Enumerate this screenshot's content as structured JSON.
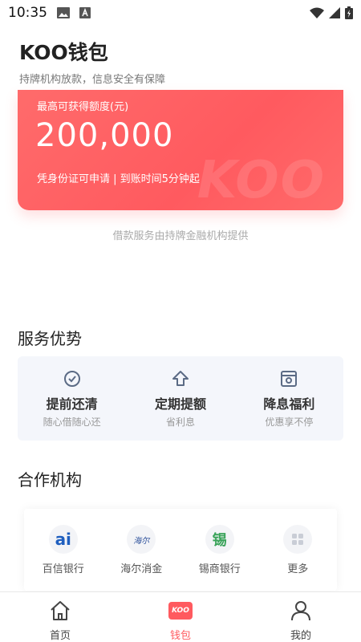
{
  "status_bar": {
    "time": "10:35"
  },
  "header": {
    "title": "KOO钱包",
    "subtitle": "持牌机构放款，信息安全有保障"
  },
  "card": {
    "label": "最高可获得额度(元)",
    "amount": "200,000",
    "note": "凭身份证可申请 | 到账时间5分钟起",
    "watermark": "KOO"
  },
  "provider_note": "借款服务由持牌金融机构提供",
  "advantages": {
    "title": "服务优势",
    "items": [
      {
        "title": "提前还清",
        "sub": "随心借随心还",
        "icon": "check-circle-icon"
      },
      {
        "title": "定期提额",
        "sub": "省利息",
        "icon": "arrow-up-icon"
      },
      {
        "title": "降息福利",
        "sub": "优惠享不停",
        "icon": "discount-icon"
      }
    ]
  },
  "partners": {
    "title": "合作机构",
    "items": [
      {
        "name": "百信银行",
        "logo_text": "ai",
        "icon": "baixin-bank-logo"
      },
      {
        "name": "海尔消金",
        "logo_text": "海尔",
        "icon": "haier-finance-logo"
      },
      {
        "name": "锡商银行",
        "logo_text": "锡",
        "icon": "xishang-bank-logo"
      },
      {
        "name": "更多",
        "logo_text": "",
        "icon": "more-grid-icon"
      }
    ]
  },
  "tabs": [
    {
      "label": "首页",
      "icon": "home-icon"
    },
    {
      "label": "钱包",
      "icon": "wallet-koo-icon",
      "badge": "KOO"
    },
    {
      "label": "我的",
      "icon": "person-icon"
    }
  ],
  "colors": {
    "accent": "#ff5a5f",
    "icon_gray": "#5b6b85"
  }
}
